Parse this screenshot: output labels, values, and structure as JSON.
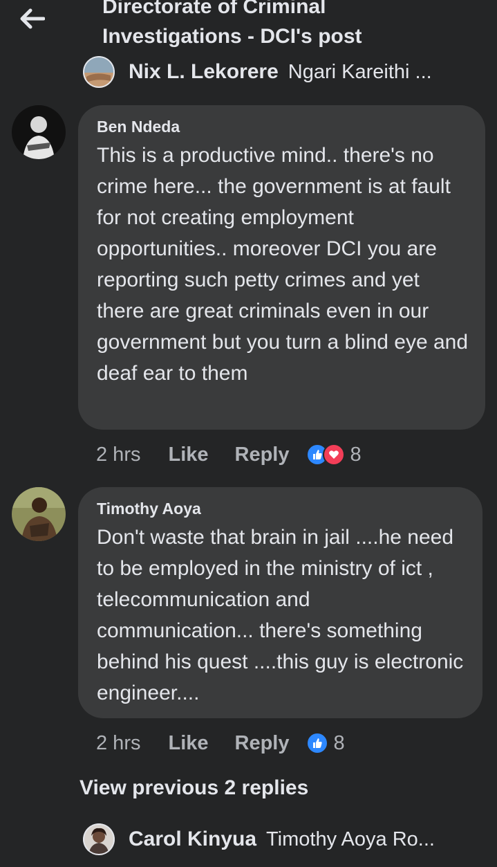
{
  "header": {
    "title": "Directorate of Criminal\nInvestigations - DCI's post"
  },
  "reply_preview_top": {
    "name": "Nix L. Lekorere",
    "text": "Ngari Kareithi ..."
  },
  "comments": [
    {
      "author": "Ben Ndeda",
      "text": "This is a productive mind.. there's no crime here... the government is at fault for not creating employment opportunities.. moreover DCI you are reporting such petty crimes and yet there are great criminals even in our government but you turn a blind eye and deaf ear to them",
      "time": "2 hrs",
      "like_label": "Like",
      "reply_label": "Reply",
      "reaction_count": "8",
      "reactions": [
        "like-icon",
        "love-icon"
      ]
    },
    {
      "author": "Timothy Aoya",
      "text": "Don't waste that brain in jail ....he need to be employed in the ministry of ict , telecommunication and communication... there's something behind his quest ....this guy is electronic engineer....",
      "time": "2 hrs",
      "like_label": "Like",
      "reply_label": "Reply",
      "reaction_count": "8",
      "reactions": [
        "like-icon"
      ]
    }
  ],
  "view_previous": "View previous 2 replies",
  "reply_preview_bottom": {
    "name": "Carol Kinyua",
    "text": "Timothy Aoya Ro..."
  },
  "colors": {
    "background": "#242526",
    "bubble": "#3a3b3c",
    "text": "#e4e6eb",
    "secondary_text": "#b0b3b8",
    "like_blue": "#2d88ff",
    "love_red": "#f33e58"
  }
}
